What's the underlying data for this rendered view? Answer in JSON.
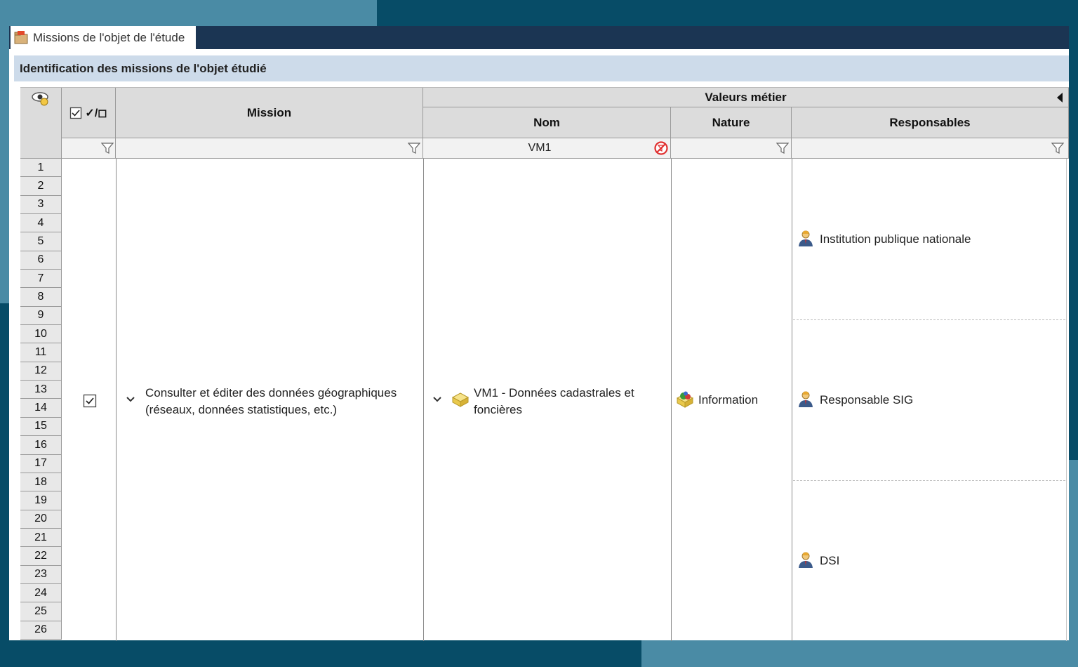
{
  "window": {
    "tab_label": "Missions de l'objet de l'étude",
    "section_title": "Identification des missions de l'objet étudié"
  },
  "grid": {
    "header": {
      "visibility_icon": "eye-icon",
      "check_toggle_label": "✓/◻",
      "mission": "Mission",
      "group": "Valeurs métier",
      "nom": "Nom",
      "nature": "Nature",
      "responsables": "Responsables"
    },
    "filters": {
      "nom_value": "VM1"
    },
    "row_numbers": [
      "1",
      "2",
      "3",
      "4",
      "5",
      "6",
      "7",
      "8",
      "9",
      "10",
      "11",
      "12",
      "13",
      "14",
      "15",
      "16",
      "17",
      "18",
      "19",
      "20",
      "21",
      "22",
      "23",
      "24",
      "25",
      "26"
    ],
    "record": {
      "checked": true,
      "mission_line1": "Consulter et éditer des données géographiques",
      "mission_line2": "(réseaux, données statistiques, etc.)",
      "nom_line1": "VM1 - Données cadastrales et",
      "nom_line2": "foncières",
      "nature": "Information",
      "responsables": [
        "Institution publique nationale",
        "Responsable SIG",
        "DSI"
      ]
    }
  },
  "colors": {
    "title_bar": "#1b3553",
    "section_header": "#cddbea",
    "clear_filter": "#e03030"
  }
}
